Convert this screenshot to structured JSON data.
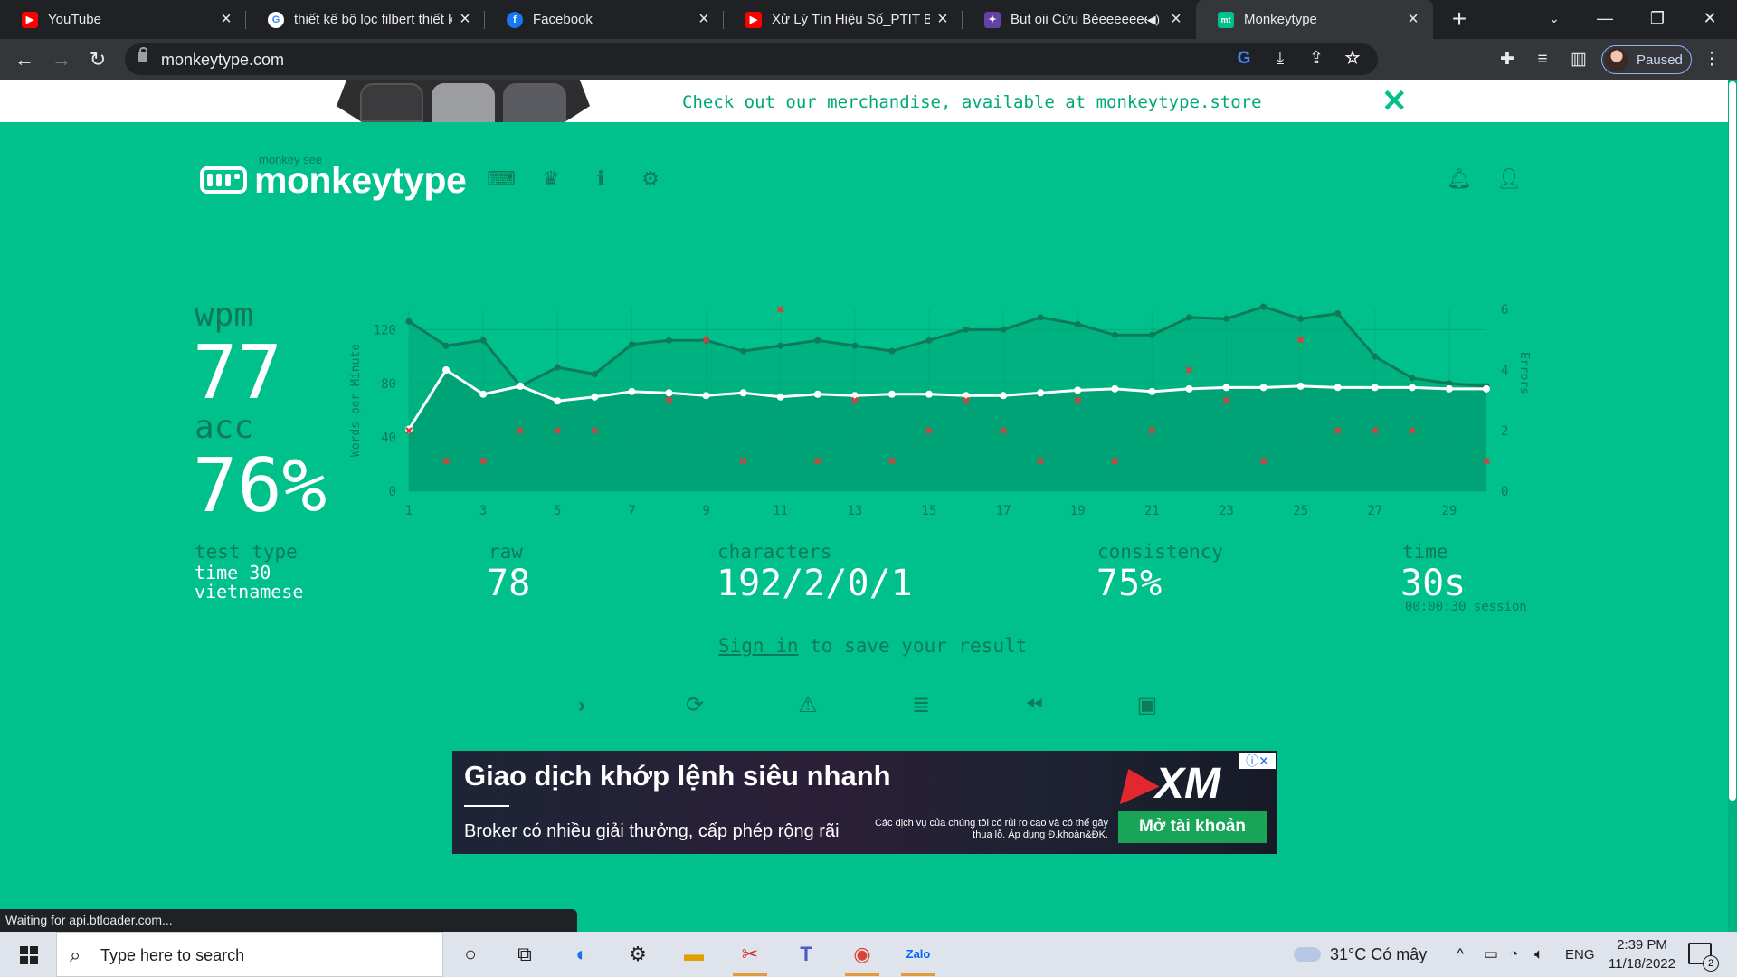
{
  "browser": {
    "tabs": [
      {
        "title": "YouTube",
        "icon": "youtube-icon",
        "color": "#ff0000"
      },
      {
        "title": "thiết kế bộ lọc filbert thiết kế",
        "icon": "google-icon",
        "color": "#4285f4"
      },
      {
        "title": "Facebook",
        "icon": "facebook-icon",
        "color": "#1877f2"
      },
      {
        "title": "Xử Lý Tín Hiệu Số_PTIT Buổi",
        "icon": "youtube-icon",
        "color": "#ff0000"
      },
      {
        "title": "But oii Cứu Béeeeeeee",
        "icon": "twitch-icon",
        "color": "#6441a5"
      },
      {
        "title": "Monkeytype",
        "icon": "monkeytype-icon",
        "color": "#00c18c"
      }
    ],
    "url": "monkeytype.com",
    "profile_label": "Paused",
    "status_text": "Waiting for api.btloader.com..."
  },
  "banner": {
    "message": "Check out our merchandise, available at",
    "link": "monkeytype.store"
  },
  "header": {
    "logo_small": "monkey see",
    "logo": "monkeytype"
  },
  "result": {
    "wpm_label": "wpm",
    "wpm": "77",
    "acc_label": "acc",
    "acc": "76%",
    "test_type_label": "test type",
    "test_type_line1": "time 30",
    "test_type_line2": "vietnamese",
    "raw_label": "raw",
    "raw": "78",
    "characters_label": "characters",
    "characters": "192/2/0/1",
    "consistency_label": "consistency",
    "consistency": "75%",
    "time_label": "time",
    "time": "30s",
    "session": "00:00:30 session",
    "signin_link": "Sign in",
    "signin_rest": " to save your result"
  },
  "chart_data": {
    "type": "line",
    "ylabel": "Words per Minute",
    "y2label": "Errors",
    "ylim": [
      0,
      135
    ],
    "y2lim": [
      0,
      6
    ],
    "yticks": [
      0,
      40,
      80,
      120
    ],
    "y2ticks": [
      0,
      2,
      4,
      6
    ],
    "xticks": [
      1,
      3,
      5,
      7,
      9,
      11,
      13,
      15,
      17,
      19,
      21,
      23,
      25,
      27,
      29
    ],
    "x": [
      1,
      2,
      3,
      4,
      5,
      6,
      7,
      8,
      9,
      10,
      11,
      12,
      13,
      14,
      15,
      16,
      17,
      18,
      19,
      20,
      21,
      22,
      23,
      24,
      25,
      26,
      27,
      28,
      29,
      30
    ],
    "series": [
      {
        "name": "wpm",
        "color": "#ffffff",
        "values": [
          46,
          90,
          72,
          78,
          67,
          70,
          74,
          73,
          71,
          73,
          70,
          72,
          71,
          72,
          72,
          71,
          71,
          73,
          75,
          76,
          74,
          76,
          77,
          77,
          78,
          77,
          77,
          77,
          76,
          76
        ]
      },
      {
        "name": "raw",
        "color": "#0e7a57",
        "values": [
          126,
          108,
          112,
          78,
          92,
          87,
          109,
          112,
          112,
          104,
          108,
          112,
          108,
          104,
          112,
          120,
          120,
          129,
          124,
          116,
          116,
          129,
          128,
          137,
          128,
          132,
          100,
          84,
          80,
          78
        ]
      },
      {
        "name": "errors",
        "color": "#e03c3c",
        "x": [
          1,
          2,
          3,
          4,
          5,
          6,
          8,
          9,
          10,
          11,
          12,
          13,
          14,
          15,
          16,
          17,
          18,
          19,
          20,
          21,
          22,
          23,
          24,
          25,
          26,
          27,
          28,
          30
        ],
        "values": [
          2,
          1,
          1,
          2,
          2,
          2,
          3,
          5,
          1,
          6,
          1,
          3,
          1,
          2,
          3,
          2,
          1,
          3,
          1,
          2,
          4,
          3,
          1,
          5,
          2,
          2,
          2,
          1
        ]
      }
    ]
  },
  "colors": {
    "background": "#00c18c",
    "sub": "#0e7a57",
    "text": "#ffffff",
    "error": "#e03c3c"
  },
  "ad": {
    "headline": "Giao dịch khớp lệnh siêu nhanh",
    "sub": "Broker có nhiều giải thưởng, cấp phép rộng rãi",
    "brand": "XM",
    "disclaimer": "Các dịch vụ của chúng tôi có rủi ro cao và có thể gây thua lỗ. Áp dụng Đ.khoản&ĐK.",
    "cta": "Mở tài khoản"
  },
  "taskbar": {
    "search_placeholder": "Type here to search",
    "weather": "31°C  Có mây",
    "lang": "ENG",
    "time": "2:39 PM",
    "date": "11/18/2022",
    "notifications": "2"
  }
}
